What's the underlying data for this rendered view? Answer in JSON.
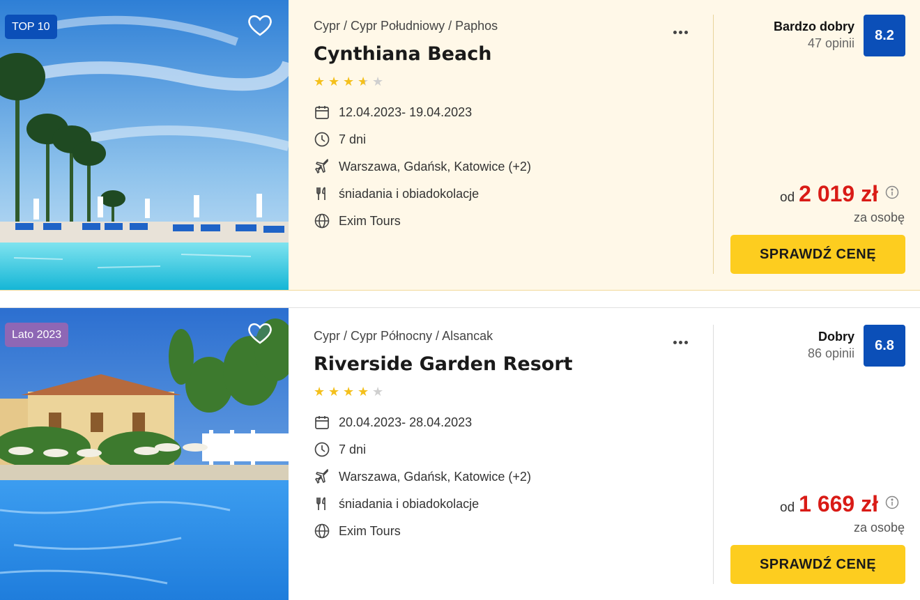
{
  "offers": [
    {
      "badge": "TOP 10",
      "badge_color": "#0b4fb8",
      "location": "Cypr / Cypr Południowy / Paphos",
      "name": "Cynthiana Beach",
      "stars": 3.5,
      "dates": "12.04.2023- 19.04.2023",
      "duration": "7 dni",
      "airports": "Warszawa, Gdańsk, Katowice  (+2)",
      "board": "śniadania i obiadokolacje",
      "operator": "Exim Tours",
      "rating_label": "Bardzo dobry",
      "rating_count": "47 opinii",
      "score": "8.2",
      "price_prefix": "od",
      "price": "2 019 zł",
      "price_note": "za osobę",
      "cta": "SPRAWDŹ CENĘ"
    },
    {
      "badge": "Lato 2023",
      "badge_color": "#8e67b5",
      "location": "Cypr / Cypr Północny / Alsancak",
      "name": "Riverside Garden Resort",
      "stars": 4,
      "dates": "20.04.2023- 28.04.2023",
      "duration": "7 dni",
      "airports": "Warszawa, Gdańsk, Katowice  (+2)",
      "board": "śniadania i obiadokolacje",
      "operator": "Exim Tours",
      "rating_label": "Dobry",
      "rating_count": "86 opinii",
      "score": "6.8",
      "price_prefix": "od",
      "price": "1 669 zł",
      "price_note": "za osobę",
      "cta": "SPRAWDŹ CENĘ"
    }
  ],
  "icons": {
    "favorite": "heart-icon",
    "more": "more-options-icon",
    "dates": "calendar-icon",
    "duration": "clock-icon",
    "airports": "airplane-icon",
    "board": "cutlery-icon",
    "operator": "globe-icon",
    "price_info": "info-icon"
  },
  "colors": {
    "accent_price": "#d91b16",
    "cta_bg": "#fdcd1f",
    "score_bg": "#0b4fb8",
    "star": "#f4c01c"
  }
}
